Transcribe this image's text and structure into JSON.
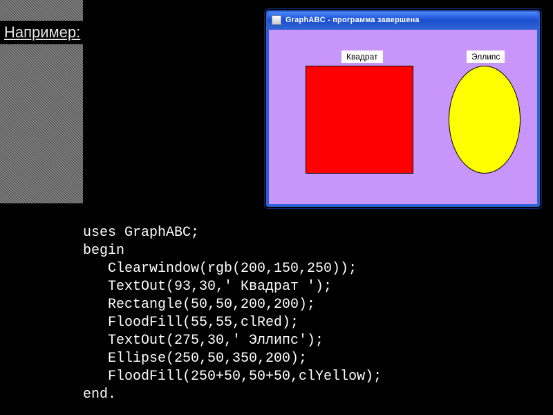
{
  "slide": {
    "title": "Например:"
  },
  "abc_window": {
    "title": "GraphABC - программа завершена",
    "canvas_bg": "rgb(200,150,250)",
    "labels": {
      "square": "Квадрат",
      "ellipse": "Эллипс"
    },
    "shapes": {
      "square_color": "#ff0000",
      "ellipse_color": "#ffff00"
    }
  },
  "code": {
    "line1": "uses GraphABC;",
    "line2": "begin",
    "line3": "   Clearwindow(rgb(200,150,250));",
    "line4": "   TextOut(93,30,' Квадрат ');",
    "line5": "   Rectangle(50,50,200,200);",
    "line6": "   FloodFill(55,55,clRed);",
    "line7": "   TextOut(275,30,' Эллипс');",
    "line8": "   Ellipse(250,50,350,200);",
    "line9": "   FloodFill(250+50,50+50,clYellow);",
    "line10": "end."
  }
}
